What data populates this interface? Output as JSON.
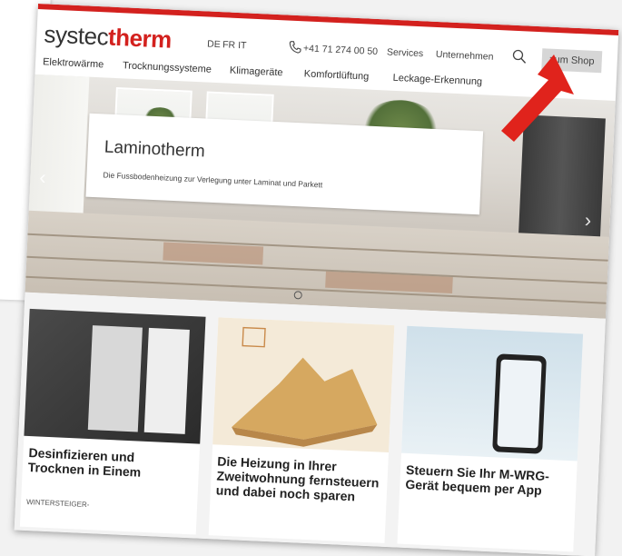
{
  "logo": {
    "part1": "systec",
    "part2": "therm"
  },
  "header": {
    "languages": [
      "DE",
      "FR",
      "IT"
    ],
    "phone": "+41 71 274 00 50",
    "links": [
      "Services",
      "Unternehmen"
    ],
    "shop_button": "zum Shop"
  },
  "nav": {
    "items": [
      "Elektrowärme",
      "Trocknungssysteme",
      "Klimageräte",
      "Komfortlüftung",
      "Leckage-Erkennung"
    ]
  },
  "hero": {
    "title": "Laminotherm",
    "subtitle": "Die Fussbodenheizung zur Verlegung unter Laminat und Parkett"
  },
  "tiles": [
    {
      "title": "Desinfizieren und Trocknen in Einem",
      "meta": "WINTERSTEIGER-"
    },
    {
      "title": "Die Heizung in Ihrer Zweitwohnung fernsteuern und dabei noch sparen",
      "meta": ""
    },
    {
      "title": "Steuern Sie Ihr M-WRG-Gerät bequem per App",
      "meta": ""
    }
  ],
  "colors": {
    "brand_red": "#d3211e",
    "arrow_red": "#e0231c"
  }
}
